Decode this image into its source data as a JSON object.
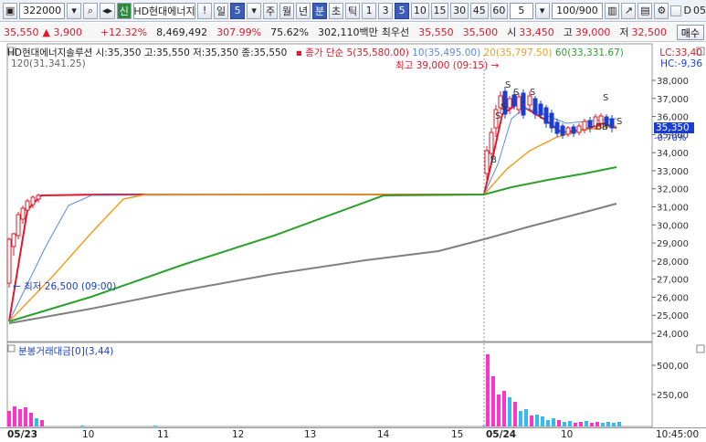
{
  "toolbar": {
    "code": "322000",
    "name": "HD현대에너지",
    "shin_badge": "신",
    "excl": "!",
    "period_day": "일",
    "period_value": "5",
    "week": "주",
    "month": "월",
    "year": "년",
    "minute": "분",
    "second": "초",
    "tick": "틱",
    "intervals": [
      "1",
      "3",
      "5",
      "10",
      "15",
      "30",
      "45",
      "60"
    ],
    "count_value": "5",
    "range": "100/900",
    "checkbox_label": "D",
    "extra": "05"
  },
  "quote": {
    "price": "35,550",
    "change": "3,900",
    "change_pct": "+12.32%",
    "volume": "8,469,492",
    "vol_ratio": "307.99%",
    "turnover_ratio": "75.62%",
    "amount": "302,110백만",
    "best_label": "최우선",
    "best_ask": "35,550",
    "best_bid": "35,500",
    "open_label": "시",
    "open": "33,450",
    "high_label": "고",
    "high": "39,000",
    "low_label": "저",
    "low": "32,500",
    "buy_label": "매수"
  },
  "legend": {
    "ohlc": "HD현대에너지솔루션 시:35,350 고:35,550 저:35,350 종:35,550",
    "ma_label": "종가 단순",
    "ma5": "5(35,580.00)",
    "ma10": "10(35,495.00)",
    "ma20": "20(35,797.50)",
    "ma60": "60(33,331.67)",
    "ma120": "120(31,341.25)",
    "high_note": "최고 39,000 (09:15)",
    "low_note": "최저 26,500 (09:00)",
    "lc": "LC:33,40",
    "hc": "HC:-9,36",
    "current_price": "35,350",
    "current_pct": "-0.70%"
  },
  "volume_panel": {
    "title": "분봉거래대금[0](3,44)",
    "ticks": [
      "500,00",
      "250,00"
    ]
  },
  "price_ticks": [
    "38,000",
    "37,000",
    "36,000",
    "35,000",
    "34,000",
    "33,000",
    "32,000",
    "31,000",
    "30,000",
    "29,000",
    "28,000",
    "27,000",
    "26,000",
    "25,000",
    "24,000"
  ],
  "date_axis": {
    "labels": [
      "05/23",
      "10",
      "11",
      "12",
      "13",
      "14",
      "15",
      "05/24",
      "10"
    ],
    "time": "10:45:00"
  },
  "colors": {
    "up": "#e0192a",
    "down": "#1a3fd0",
    "ma5": "#e0192a",
    "ma10": "#5b8be6",
    "ma20": "#f0a020",
    "ma60": "#2ea02e",
    "ma120": "#808080"
  }
}
